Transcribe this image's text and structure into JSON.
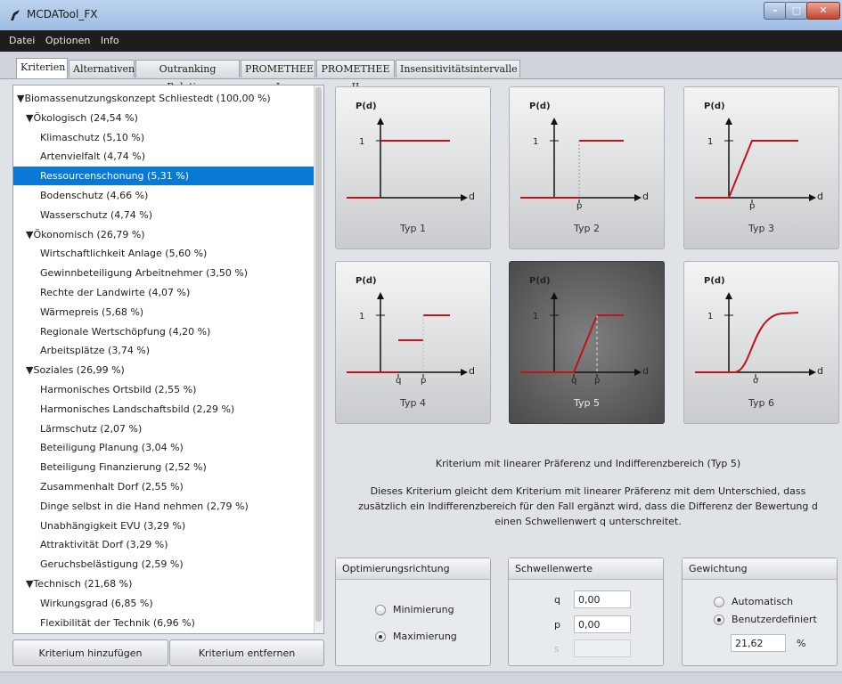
{
  "window": {
    "title": "MCDATool_FX",
    "minimize": "–",
    "maximize": "□",
    "close": "✕"
  },
  "menu": [
    "Datei",
    "Optionen",
    "Info"
  ],
  "tabs": [
    "Kriterien",
    "Alternativen",
    "Outranking Relation",
    "PROMETHEE I",
    "PROMETHEE II",
    "Insensitivitätsintervalle"
  ],
  "active_tab": "Kriterien",
  "tree": [
    {
      "label": "▼Biomassenutzungskonzept Schliestedt (100,00 %)",
      "level": 0
    },
    {
      "label": "▼Ökologisch (24,54 %)",
      "level": 1
    },
    {
      "label": "Klimaschutz (5,10 %)",
      "level": 2
    },
    {
      "label": "Artenvielfalt (4,74 %)",
      "level": 2
    },
    {
      "label": "Ressourcenschonung (5,31 %)",
      "level": 2,
      "selected": true
    },
    {
      "label": "Bodenschutz (4,66 %)",
      "level": 2
    },
    {
      "label": "Wasserschutz (4,74 %)",
      "level": 2
    },
    {
      "label": "▼Ökonomisch (26,79 %)",
      "level": 1
    },
    {
      "label": "Wirtschaftlichkeit Anlage (5,60 %)",
      "level": 2
    },
    {
      "label": "Gewinnbeteiligung Arbeitnehmer (3,50 %)",
      "level": 2
    },
    {
      "label": "Rechte der Landwirte (4,07 %)",
      "level": 2
    },
    {
      "label": "Wärmepreis (5,68 %)",
      "level": 2
    },
    {
      "label": "Regionale Wertschöpfung (4,20 %)",
      "level": 2
    },
    {
      "label": "Arbeitsplätze (3,74 %)",
      "level": 2
    },
    {
      "label": "▼Soziales (26,99 %)",
      "level": 1
    },
    {
      "label": "Harmonisches Ortsbild (2,55 %)",
      "level": 2
    },
    {
      "label": "Harmonisches Landschaftsbild (2,29 %)",
      "level": 2
    },
    {
      "label": "Lärmschutz (2,07 %)",
      "level": 2
    },
    {
      "label": "Beteiligung Planung (3,04 %)",
      "level": 2
    },
    {
      "label": "Beteiligung Finanzierung (2,52 %)",
      "level": 2
    },
    {
      "label": "Zusammenhalt Dorf (2,55 %)",
      "level": 2
    },
    {
      "label": "Dinge selbst in die Hand nehmen (2,79 %)",
      "level": 2
    },
    {
      "label": "Unabhängigkeit EVU (3,29 %)",
      "level": 2
    },
    {
      "label": "Attraktivität Dorf (3,29 %)",
      "level": 2
    },
    {
      "label": "Geruchsbelästigung (2,59 %)",
      "level": 2
    },
    {
      "label": "▼Technisch (21,68 %)",
      "level": 1
    },
    {
      "label": "Wirkungsgrad (6,85 %)",
      "level": 2
    },
    {
      "label": "Flexibilität der Technik (6,96 %)",
      "level": 2
    }
  ],
  "buttons": {
    "add": "Kriterium hinzufügen",
    "remove": "Kriterium entfernen"
  },
  "types": [
    {
      "label": "Typ 1",
      "kind": "usual",
      "axis_labels": []
    },
    {
      "label": "Typ 2",
      "kind": "u-shape",
      "axis_labels": [
        "p"
      ]
    },
    {
      "label": "Typ 3",
      "kind": "v-shape",
      "axis_labels": [
        "p"
      ]
    },
    {
      "label": "Typ 4",
      "kind": "level",
      "axis_labels": [
        "q",
        "p"
      ]
    },
    {
      "label": "Typ 5",
      "kind": "linear",
      "axis_labels": [
        "q",
        "p"
      ],
      "selected": true
    },
    {
      "label": "Typ 6",
      "kind": "gaussian",
      "axis_labels": [
        "σ"
      ]
    }
  ],
  "graph": {
    "ylabel": "P(d)",
    "xlabel": "d",
    "one": "1",
    "curve_color": "#c0141c"
  },
  "description": {
    "title": "Kriterium mit linearer Präferenz und Indifferenzbereich (Typ 5)",
    "line1": "Dieses Kriterium gleicht dem Kriterium mit linearer Präferenz mit dem Unterschied, dass",
    "line2": "zusätzlich ein Indifferenzbereich für den Fall ergänzt wird, dass die Differenz der Bewertung d",
    "line3": "einen Schwellenwert q unterschreitet."
  },
  "optimization": {
    "header": "Optimierungsrichtung",
    "min": "Minimierung",
    "max": "Maximierung",
    "selected": "Maximierung"
  },
  "thresholds": {
    "header": "Schwellenwerte",
    "q_label": "q",
    "q_value": "0,00",
    "p_label": "p",
    "p_value": "0,00",
    "s_label": "s",
    "s_value": ""
  },
  "weighting": {
    "header": "Gewichtung",
    "auto": "Automatisch",
    "custom": "Benutzerdefiniert",
    "selected": "Benutzerdefiniert",
    "value": "21,62",
    "unit": "%"
  }
}
